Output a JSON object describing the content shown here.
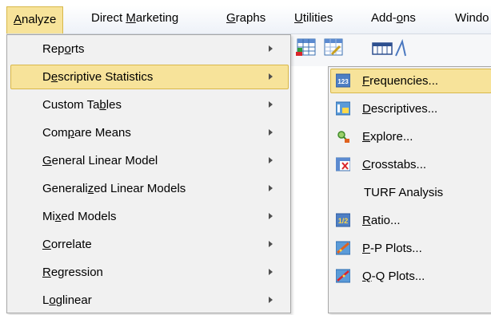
{
  "menubar": {
    "items": [
      {
        "pre": "",
        "u": "A",
        "post": "nalyze",
        "active": true
      },
      {
        "pre": "Direct ",
        "u": "M",
        "post": "arketing",
        "active": false
      },
      {
        "pre": "",
        "u": "G",
        "post": "raphs",
        "active": false
      },
      {
        "pre": "",
        "u": "U",
        "post": "tilities",
        "active": false
      },
      {
        "pre": "Add-",
        "u": "o",
        "post": "ns",
        "active": false
      },
      {
        "pre": "Windo",
        "u": "",
        "post": "",
        "active": false
      }
    ]
  },
  "analyze_menu": {
    "items": [
      {
        "pre": "Rep",
        "u": "o",
        "post": "rts"
      },
      {
        "pre": "D",
        "u": "e",
        "post": "scriptive Statistics"
      },
      {
        "pre": "Custom Ta",
        "u": "b",
        "post": "les"
      },
      {
        "pre": "Com",
        "u": "p",
        "post": "are Means"
      },
      {
        "pre": "",
        "u": "G",
        "post": "eneral Linear Model"
      },
      {
        "pre": "Generali",
        "u": "z",
        "post": "ed Linear Models"
      },
      {
        "pre": "Mi",
        "u": "x",
        "post": "ed Models"
      },
      {
        "pre": "",
        "u": "C",
        "post": "orrelate"
      },
      {
        "pre": "",
        "u": "R",
        "post": "egression"
      },
      {
        "pre": "L",
        "u": "o",
        "post": "glinear"
      }
    ]
  },
  "descriptive_submenu": {
    "items": [
      {
        "pre": "",
        "u": "F",
        "post": "requencies...",
        "icon": "frequencies-icon"
      },
      {
        "pre": "",
        "u": "D",
        "post": "escriptives...",
        "icon": "descriptives-icon"
      },
      {
        "pre": "",
        "u": "E",
        "post": "xplore...",
        "icon": "explore-icon"
      },
      {
        "pre": "",
        "u": "C",
        "post": "rosstabs...",
        "icon": "crosstabs-icon"
      },
      {
        "pre": "TURF Analysis",
        "u": "",
        "post": "",
        "icon": ""
      },
      {
        "pre": "",
        "u": "R",
        "post": "atio...",
        "icon": "ratio-icon"
      },
      {
        "pre": "",
        "u": "P",
        "post": "-P Plots...",
        "icon": "pp-plots-icon"
      },
      {
        "pre": "",
        "u": "Q",
        "post": "-Q Plots...",
        "icon": "qq-plots-icon"
      }
    ]
  },
  "icons": {
    "frequencies_text": "123",
    "ratio_text": "1/2"
  },
  "colors": {
    "highlight": "#f7e39a",
    "highlight_border": "#d8b84a",
    "menu_bg": "#f1f1f1"
  }
}
